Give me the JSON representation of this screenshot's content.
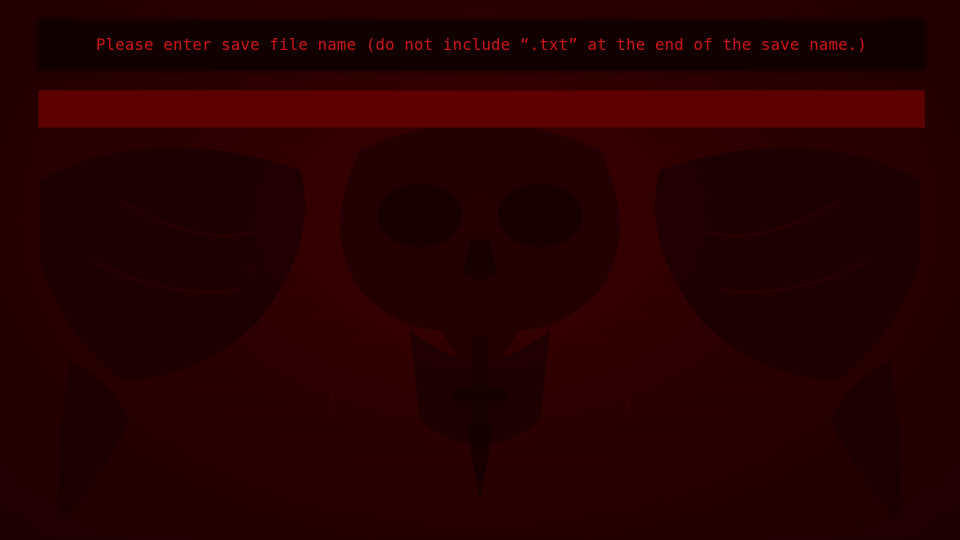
{
  "dialog": {
    "prompt": "Please enter save file name (do not include “.txt” at the end of the save name.)",
    "input_value": "",
    "input_placeholder": ""
  },
  "background": {
    "image": "demonic-skull-artwork",
    "colors": {
      "base": "#2a0000",
      "prompt_text": "#d11414",
      "prompt_box": "#120000",
      "input_fill": "#5e0000"
    }
  }
}
